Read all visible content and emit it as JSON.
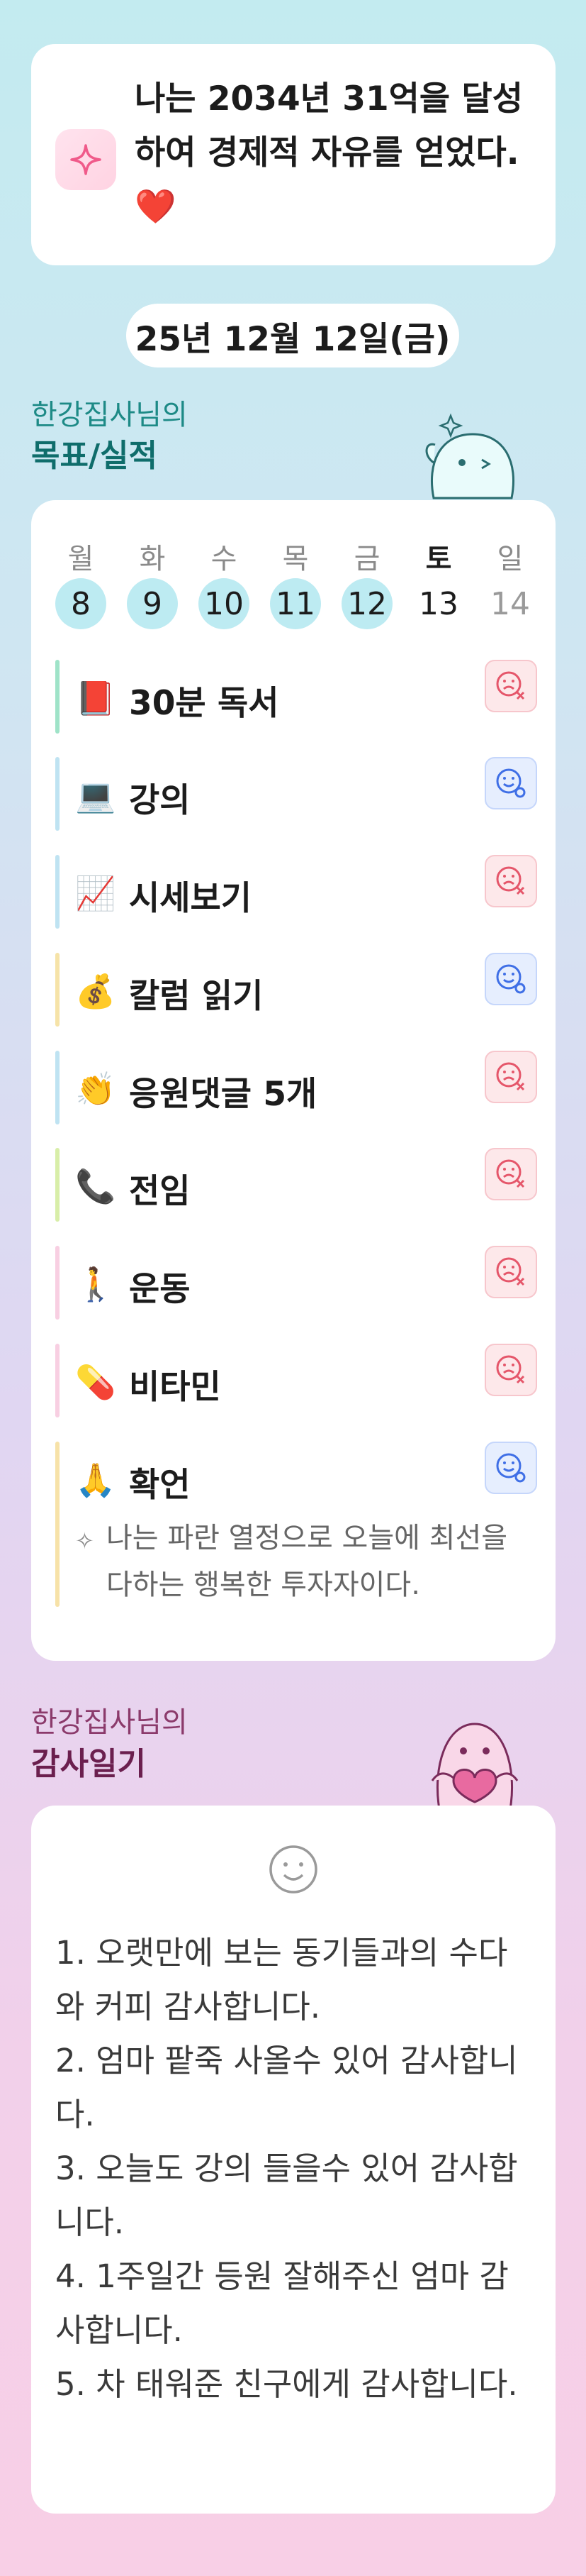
{
  "affirmation": {
    "text": "나는 2034년 31억을 달성하여 경제적 자유를 얻었다.",
    "emoji": "❤️",
    "icon": "sparkle-icon"
  },
  "date": "25년 12월 12일(금)",
  "goals_section": {
    "subtitle": "한강집사님의",
    "title": "목표/실적"
  },
  "week": {
    "days": [
      {
        "label": "월",
        "num": "8",
        "done": true
      },
      {
        "label": "화",
        "num": "9",
        "done": true
      },
      {
        "label": "수",
        "num": "10",
        "done": true
      },
      {
        "label": "목",
        "num": "11",
        "done": true
      },
      {
        "label": "금",
        "num": "12",
        "done": true
      },
      {
        "label": "토",
        "num": "13",
        "done": false
      },
      {
        "label": "일",
        "num": "14",
        "done": false
      }
    ]
  },
  "goals": [
    {
      "emoji": "📕",
      "label": "30분 독서",
      "status": "fail",
      "bar_color": "#9fe3c8"
    },
    {
      "emoji": "💻",
      "label": "강의",
      "status": "ok",
      "bar_color": "#bfe3f2"
    },
    {
      "emoji": "📈",
      "label": "시세보기",
      "status": "fail",
      "bar_color": "#bfe3f2"
    },
    {
      "emoji": "💰",
      "label": "칼럼 읽기",
      "status": "ok",
      "bar_color": "#f6e3a8"
    },
    {
      "emoji": "👏",
      "label": "응원댓글 5개",
      "status": "fail",
      "bar_color": "#bfe3f2"
    },
    {
      "emoji": "📞",
      "label": "전임",
      "status": "fail",
      "bar_color": "#d8eea8"
    },
    {
      "emoji": "🚶",
      "label": "운동",
      "status": "fail",
      "bar_color": "#f8cfe2"
    },
    {
      "emoji": "💊",
      "label": "비타민",
      "status": "fail",
      "bar_color": "#f8cfe2"
    },
    {
      "emoji": "🙏",
      "label": "확언",
      "status": "ok",
      "bar_color": "#f7e2a8"
    }
  ],
  "goal_note": "나는 파란 열정으로 오늘에 최선을 다하는 행복한 투자자이다.",
  "gratitude_section": {
    "subtitle": "한강집사님의",
    "title": "감사일기"
  },
  "gratitude": [
    "1. 오랫만에 보는 동기들과의 수다와 커피 감사합니다.",
    "2. 엄마 팥죽 사올수 있어 감사합니다.",
    "3. 오늘도 강의 들을수 있어 감사합니다.",
    "4. 1주일간 등원 잘해주신 엄마 감사합니다.",
    "5. 차 태워준 친구에게 감사합니다."
  ],
  "colors": {
    "goals_title": "#0f6d6b",
    "goals_sub": "#1d8a86",
    "grat_title": "#6b1f4e",
    "grat_sub": "#8b3a6b",
    "fail": "#e5566a",
    "ok": "#3f6fe6"
  }
}
